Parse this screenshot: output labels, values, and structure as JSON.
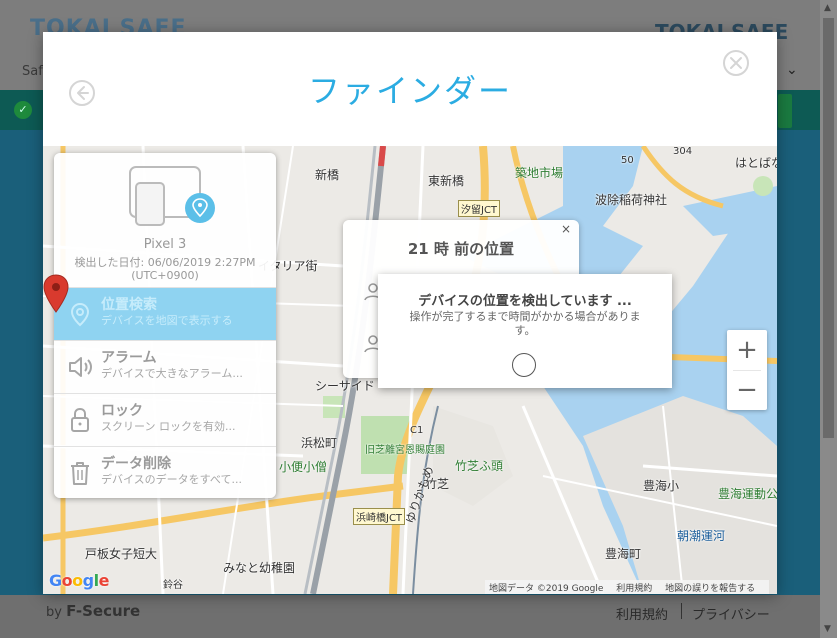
{
  "background": {
    "logo_left": "TOKAI SAFE",
    "logo_right": "TOKAI SAFE",
    "nav_left": "Safe",
    "nav_right_chevron": "⌄",
    "footer_by": "by",
    "footer_brand": "F-Secure",
    "footer_links": [
      "利用規約",
      "プライバシー"
    ]
  },
  "modal": {
    "title": "ファインダー",
    "back_icon": "back-arrow-icon",
    "close_icon": "close-icon"
  },
  "device": {
    "name": "Pixel 3",
    "detected_label": "検出した日付: 06/06/2019 2:27PM",
    "timezone": "(UTC+0900)"
  },
  "menu": [
    {
      "title": "位置検索",
      "subtitle": "デバイスを地図で表示する",
      "icon": "location-icon",
      "active": true
    },
    {
      "title": "アラーム",
      "subtitle": "デバイスで大きなアラーム...",
      "icon": "speaker-icon",
      "active": false
    },
    {
      "title": "ロック",
      "subtitle": "スクリーン ロックを有効...",
      "icon": "lock-icon",
      "active": false
    },
    {
      "title": "データ削除",
      "subtitle": "デバイスのデータをすべて...",
      "icon": "trash-icon",
      "active": false
    }
  ],
  "infowindow": {
    "title": "21 時 前の位置",
    "close": "×"
  },
  "progress_dialog": {
    "title": "デバイスの位置を検出しています ...",
    "subtitle": "操作が完了するまで時間がかかる場合がありま す。"
  },
  "map": {
    "labels": [
      "新橋",
      "東新橋",
      "築地市場",
      "波除稲荷神社",
      "はとばな",
      "汐留JCT",
      "イタリア街",
      "シーサイド",
      "浜松町",
      "旧芝離宮恩賜庭園",
      "竹芝ふ頭",
      "竹芝",
      "小便小僧",
      "浜崎橋JCT",
      "ゆりかもめ",
      "豊海小",
      "豊海運動公",
      "朝潮運河",
      "豊海町",
      "戸板女子短大",
      "みなと幼稚園",
      "鈴谷",
      "50",
      "304",
      "C1"
    ],
    "zoom_in": "+",
    "zoom_out": "−",
    "google": "Google",
    "attribution": [
      "地図データ ©2019 Google",
      "利用規約",
      "地図の誤りを報告する"
    ]
  },
  "colors": {
    "accent": "#2bace2",
    "active_menu": "#8fd3f1",
    "water": "#a9d2f0",
    "pin": "#d93a2e"
  }
}
